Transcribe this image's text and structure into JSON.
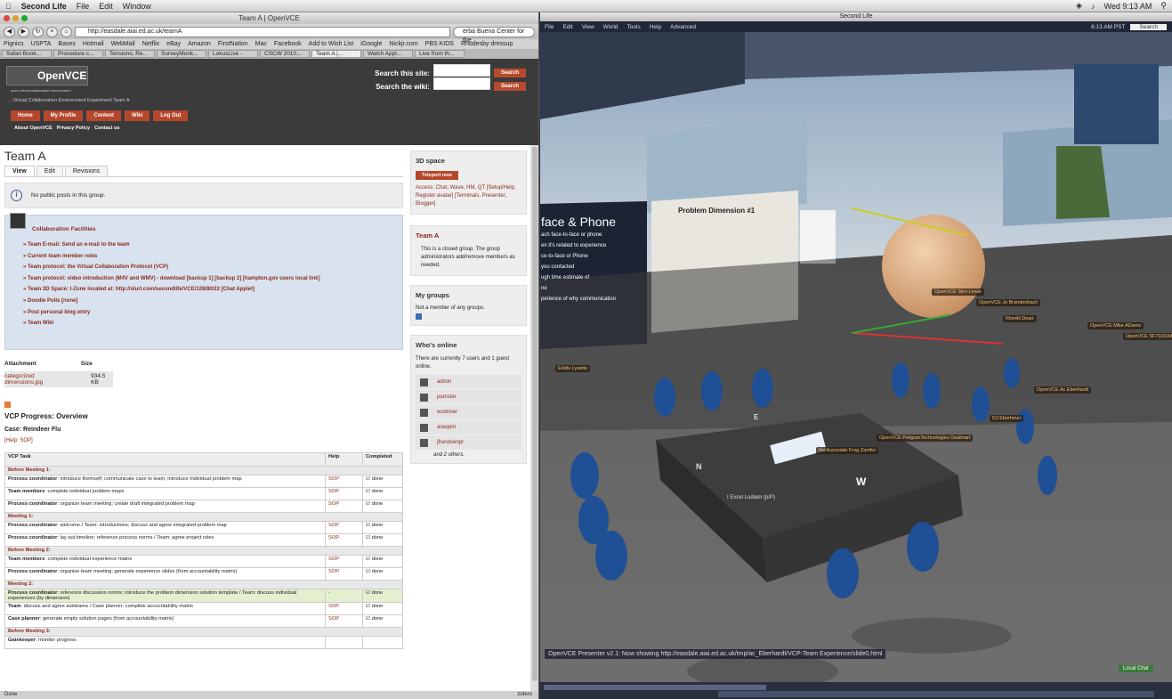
{
  "menubar": {
    "app": "Second Life",
    "items": [
      "File",
      "Edit",
      "Window"
    ],
    "clock": "Wed 9:13 AM"
  },
  "safari": {
    "window_title": "Team A | OpenVCE",
    "url": "http://easdale.aiai.ed.ac.uk/teamA",
    "search_text": "erba Buena Center for the",
    "bookmarks": [
      "Pignics",
      "USPTA",
      "Bases",
      "Hotmail",
      "WebMail",
      "Netflix",
      "eBay",
      "Amazon",
      "FirstNation",
      "Mac",
      "Facebook",
      "Add to Wish List",
      "iGoogle",
      "Nickjr.com",
      "PBS KIDS",
      "Rhodesby dressup"
    ],
    "tabs": [
      "Safari Book...",
      "Procedure c...",
      "Tensions, Re...",
      "SurveyMonk...",
      "LokusLive -",
      "CSCW 2010...",
      "Team A |...",
      "Watch Appl...",
      "Live from th..."
    ],
    "status": "Done",
    "zotero": "zotero"
  },
  "site": {
    "logo": "OpenVCE",
    "logo_sub": "open virtual collaboration environment",
    "tagline": "...Virtual Collaboration Environment Experiment Team A",
    "search_site_label": "Search this site:",
    "search_wiki_label": "Search the wiki:",
    "search_btn": "Search",
    "nav": [
      "Home",
      "My Profile",
      "Content",
      "Wiki",
      "Log Out"
    ],
    "sublinks": [
      "About OpenVCE",
      "Privacy Policy",
      "Contact us"
    ]
  },
  "page": {
    "title": "Team A",
    "tabs": [
      "View",
      "Edit",
      "Revisions"
    ],
    "info": "No public posts in this group.",
    "collab_title": "Collaboration Facilities",
    "collab_items": [
      "Team E-mail: Send an e-mail to the team",
      "Current team member roles",
      "Team protocol: the Virtual Collaboration Protocol (VCP)",
      "Team protocol: video introduction (M4V and WMV) - download [backup 1] [backup 2] [hampton.gov users local link]",
      "Team 3D Space: I-Zone located at: http://slurl.com/secondlife/VCE/128/80/22 [Chat Applet]",
      "Doodle Polls [none]",
      "Post personal blog entry",
      "Team Wiki"
    ],
    "attach_header": "Attachment",
    "size_header": "Size",
    "attach_file": "categorized dimensions.jpg",
    "attach_size": "934.5 KB",
    "vcp_title": "VCP Progress: Overview",
    "case": "Case: Reindeer Flu",
    "help": "[Help: SOP]",
    "table_headers": [
      "VCP Task",
      "Help",
      "Completed"
    ],
    "rows": [
      {
        "type": "sec",
        "text": "Before Meeting 1:"
      },
      {
        "type": "row",
        "role": "Process coordinator",
        "text": ": introduce themself; communicate case to team; introduce individual problem map",
        "help": "SOP",
        "done": "done"
      },
      {
        "type": "row",
        "role": "Team members",
        "text": ": complete individual problem maps",
        "help": "SOP",
        "done": "done"
      },
      {
        "type": "row",
        "role": "Process coordinator",
        "text": ": organize team meeting; create draft integrated problem map",
        "help": "SOP",
        "done": "done"
      },
      {
        "type": "sec",
        "text": "Meeting 1:"
      },
      {
        "type": "row",
        "role": "Process coordinator",
        "text": ": welcome / Team: introductions; discuss and agree integrated problem map",
        "help": "SOP",
        "done": "done"
      },
      {
        "type": "row",
        "role": "Process coordinator",
        "text": ": lay out timeline; reference process norms / Team: agree project roles",
        "help": "SOP",
        "done": "done"
      },
      {
        "type": "sec",
        "text": "Before Meeting 2:"
      },
      {
        "type": "row",
        "role": "Team members",
        "text": ": complete individual experience matrix",
        "help": "SOP",
        "done": "done"
      },
      {
        "type": "row",
        "role": "Process coordinator",
        "text": ": organize team meeting; generate experience slides (from accountability matrix)",
        "help": "SOP",
        "done": "done"
      },
      {
        "type": "sec",
        "text": "Meeting 2:"
      },
      {
        "type": "hl",
        "role": "Process coordinator",
        "text": ": reference discussion norms; introduce the problem dimension solution template / Team: discuss individual experiences (by dimension)",
        "help": "-",
        "done": "done"
      },
      {
        "type": "row",
        "role": "Team",
        "text": ": discuss and agree subteams / Case planner: complete accountability matrix",
        "help": "SOP",
        "done": "done"
      },
      {
        "type": "row",
        "role": "Case planner",
        "text": ": generate empty solution pages (from accountability matrix)",
        "help": "SOP",
        "done": "done"
      },
      {
        "type": "sec",
        "text": "Before Meeting 3:"
      },
      {
        "type": "row",
        "role": "Gatekeeper",
        "text": ": monitor progress",
        "help": "",
        "done": ""
      }
    ]
  },
  "sidebar": {
    "space_title": "3D space",
    "teleport": "Teleport now",
    "access": "Access: Chat, Wave, HM, QT [Setup/Help, Register avatar] [Terminals, Presenter, Blogger]",
    "team_title": "Team A",
    "team_text": "This is a closed group. The group administrators add/remove members as needed.",
    "groups_title": "My groups",
    "groups_text": "Not a member of any groups.",
    "online_title": "Who's online",
    "online_text": "There are currently 7 users and 1 guest online.",
    "users": [
      "admin",
      "pamster",
      "wootmer",
      "araspim",
      "jfrandsenpr"
    ],
    "more": "and 2 others."
  },
  "secondlife": {
    "window_title": "Second Life",
    "menu": [
      "File",
      "Edit",
      "View",
      "World",
      "Tools",
      "Help",
      "Advanced"
    ],
    "clock": "6:13 AM PST",
    "search": "Search",
    "slide_title": "Problem Dimension #1",
    "screen_text": [
      "face & Phone",
      "ach face-to-face or phone",
      "en it's related to experience",
      "ce-to-face or Phone",
      "you contacted",
      "ugh time estimate of",
      "ne",
      "perience of why communication"
    ],
    "avatars": [
      "Eddie Lysette",
      "OpenVCE Slim Lewis",
      "OpenVCE Jo Brandenbach",
      "Riorelli Dean",
      "OpenVCE Mike ADams",
      "OpenVCE SF7020Jille",
      "OpenVCE Ac Eberhardt",
      "DJ Eberhmer",
      "Ike Associate Frog Zamfor",
      "OpenVCE PeligranTechnologies Dealmart"
    ],
    "label": "I Excel Lodiam (p/P)",
    "letter_w": "W",
    "letter_n": "N",
    "letter_e": "E",
    "chat": "OpenVCE Presenter v2.1: Now showing http://easdale.aiai.ed.ac.uk/tmp/ac_Eberhardt/VCP-Team Experience/slide0.html",
    "local_chat": "Local Chat"
  }
}
